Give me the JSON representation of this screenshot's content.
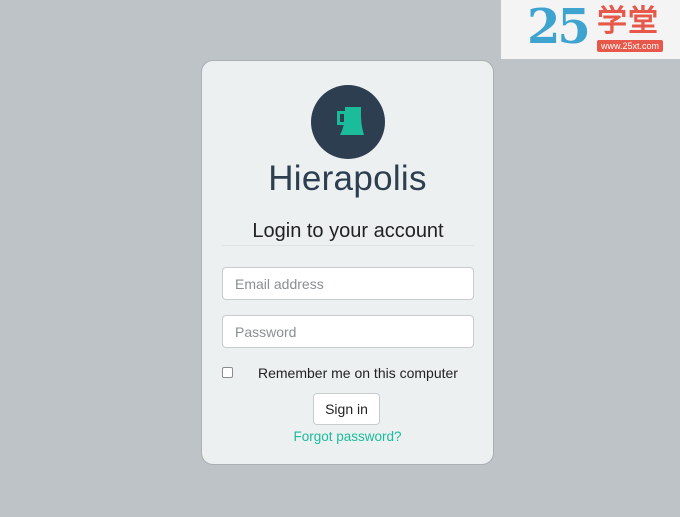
{
  "watermark": {
    "number": "25",
    "chinese": "学堂",
    "url": "www.25xt.com"
  },
  "login": {
    "logo_icon": "cup-icon",
    "brand": "Hierapolis",
    "heading": "Login to your account",
    "email_placeholder": "Email address",
    "password_placeholder": "Password",
    "email_value": "",
    "password_value": "",
    "remember_label": "Remember me on this computer",
    "remember_checked": false,
    "signin_label": "Sign in",
    "forgot_label": "Forgot password?"
  },
  "colors": {
    "page_background": "#bdc3c7",
    "card_background": "#ecf0f1",
    "logo_background": "#2c3e50",
    "logo_icon": "#1abc9c",
    "brand_text": "#2c3e50",
    "link": "#1abc9c"
  }
}
